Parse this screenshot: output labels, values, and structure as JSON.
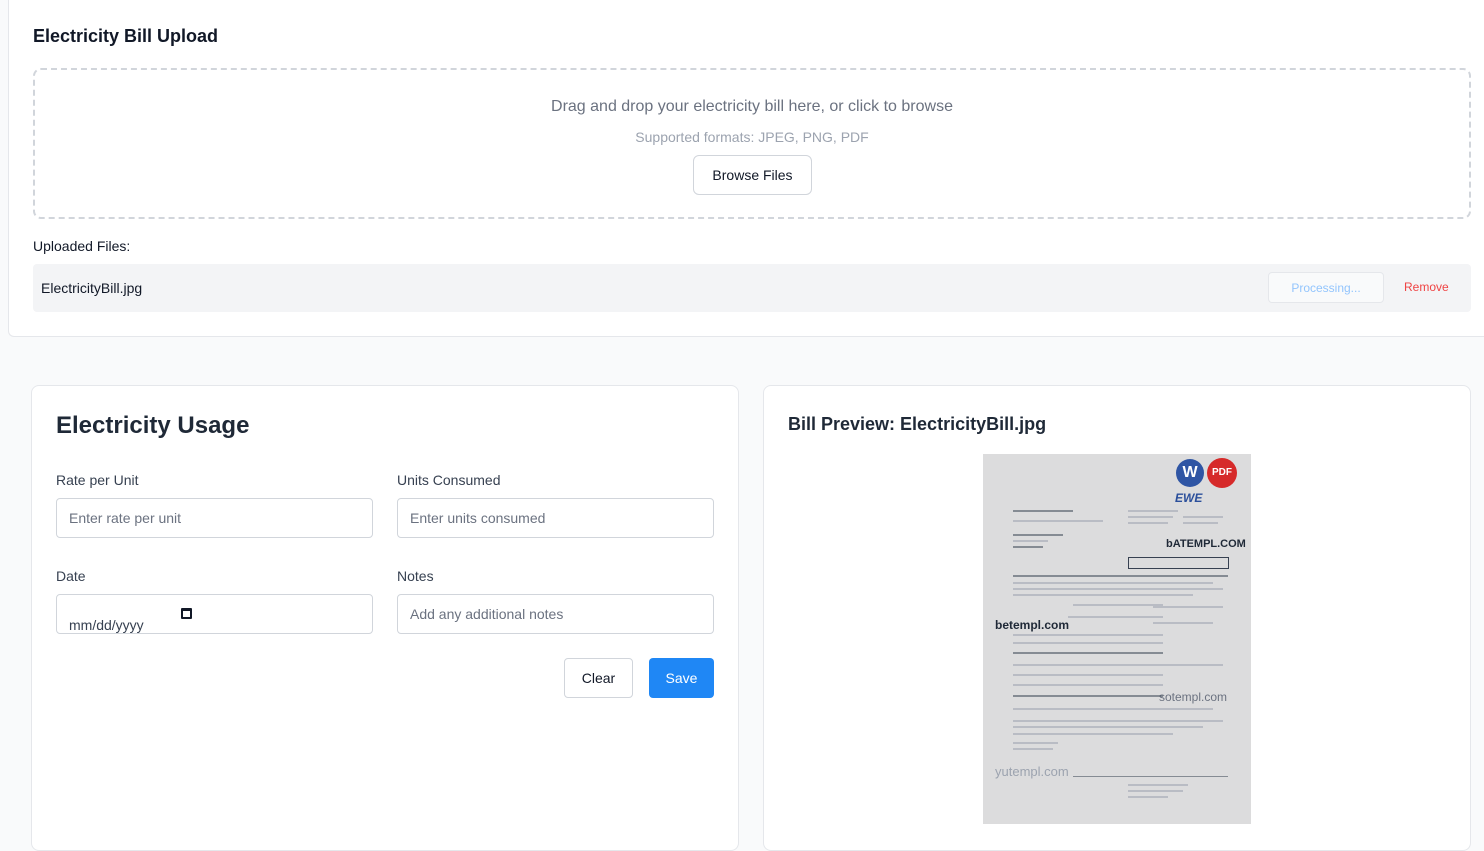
{
  "upload": {
    "title": "Electricity Bill Upload",
    "dropzone_text": "Drag and drop your electricity bill here, or click to browse",
    "formats_text": "Supported formats: JPEG, PNG, PDF",
    "browse_label": "Browse Files",
    "uploaded_label": "Uploaded Files:",
    "files": [
      {
        "name": "ElectricityBill.jpg",
        "status": "Processing...",
        "remove_label": "Remove"
      }
    ]
  },
  "usage": {
    "title": "Electricity Usage",
    "rate_label": "Rate per Unit",
    "rate_placeholder": "Enter rate per unit",
    "units_label": "Units Consumed",
    "units_placeholder": "Enter units consumed",
    "date_label": "Date",
    "date_value": "mm/dd/yyyy",
    "notes_label": "Notes",
    "notes_placeholder": "Add any additional notes",
    "clear_label": "Clear",
    "save_label": "Save"
  },
  "preview": {
    "title": "Bill Preview: ElectricityBill.jpg",
    "image": {
      "badge_w": "W",
      "badge_pdf": "PDF",
      "logo": "EWE",
      "watermarks": [
        "bATEMPL.COM",
        "betempl.com",
        "sotempl.com",
        "yutempl.com"
      ]
    }
  },
  "colors": {
    "primary": "#1f87f5",
    "danger": "#ef4444",
    "processing": "#93c5fd"
  }
}
